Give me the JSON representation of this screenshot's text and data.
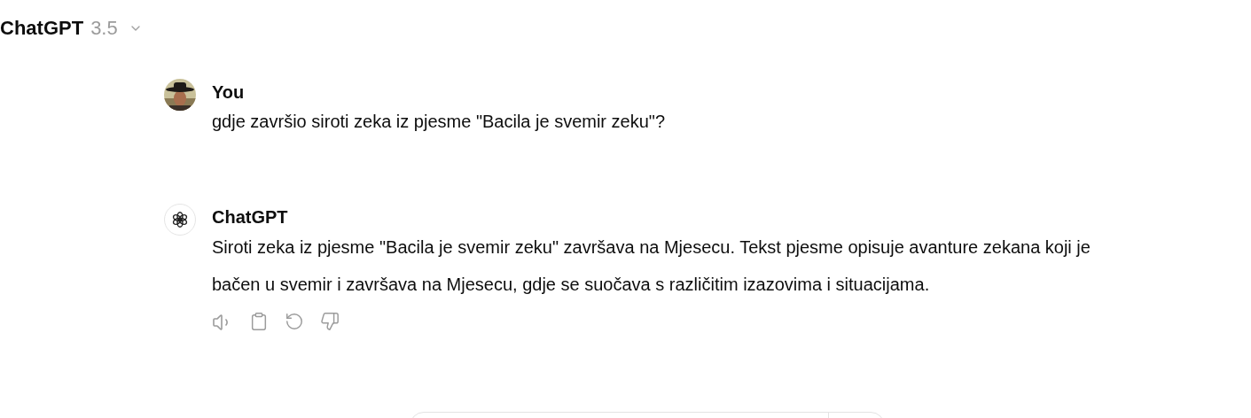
{
  "header": {
    "title": "ChatGPT",
    "version": "3.5"
  },
  "messages": [
    {
      "author": "You",
      "kind": "user",
      "text": "gdje završio siroti zeka iz pjesme \"Bacila je svemir zeku\"?"
    },
    {
      "author": "ChatGPT",
      "kind": "assistant",
      "text": "Siroti zeka iz pjesme \"Bacila je svemir zeku\" završava na Mjesecu. Tekst pjesme opisuje avanture zekana koji je bačen u svemir i završava na Mjesecu, gdje se suočava s različitim izazovima i situacijama."
    }
  ]
}
